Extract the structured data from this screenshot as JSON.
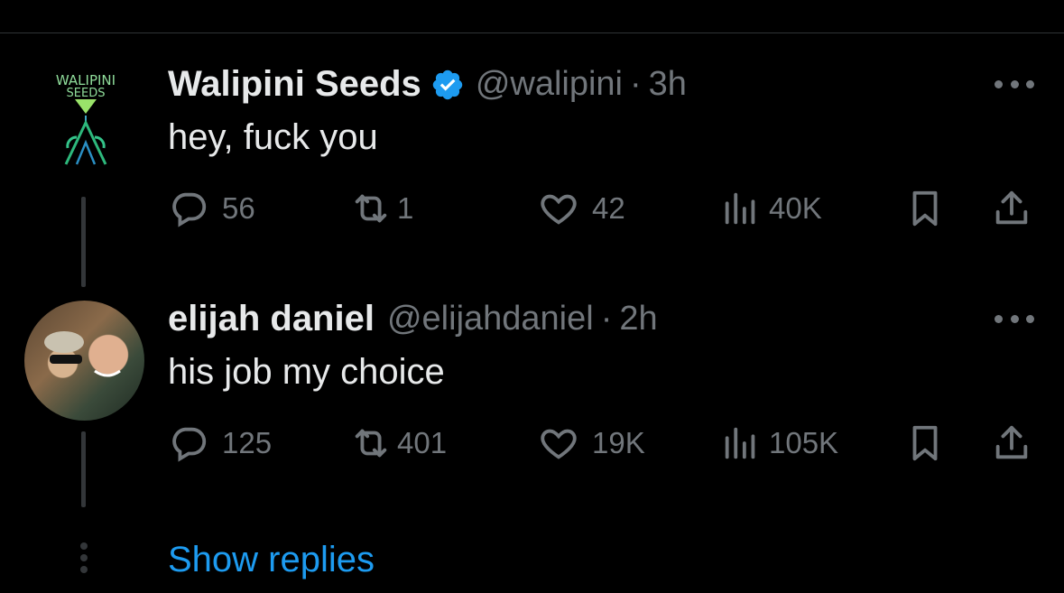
{
  "colors": {
    "background": "#000000",
    "primary_text": "#e7e9ea",
    "secondary_text": "#71767b",
    "accent": "#1d9bf0",
    "divider": "#2f3336"
  },
  "tweets": [
    {
      "author_name": "Walipini Seeds",
      "verified": true,
      "handle": "@walipini",
      "separator": "·",
      "time": "3h",
      "text": "hey, fuck you",
      "avatar_logo_text": [
        "WALIPINI",
        "SEEDS"
      ],
      "actions": {
        "replies": "56",
        "reposts": "1",
        "likes": "42",
        "views": "40K"
      },
      "icons": [
        "reply-icon",
        "repost-icon",
        "like-icon",
        "views-icon",
        "bookmark-icon",
        "share-icon"
      ]
    },
    {
      "author_name": "elijah daniel",
      "verified": false,
      "handle": "@elijahdaniel",
      "separator": "·",
      "time": "2h",
      "text": "his job my choice",
      "actions": {
        "replies": "125",
        "reposts": "401",
        "likes": "19K",
        "views": "105K"
      },
      "icons": [
        "reply-icon",
        "repost-icon",
        "like-icon",
        "views-icon",
        "bookmark-icon",
        "share-icon"
      ]
    }
  ],
  "show_replies_label": "Show replies"
}
